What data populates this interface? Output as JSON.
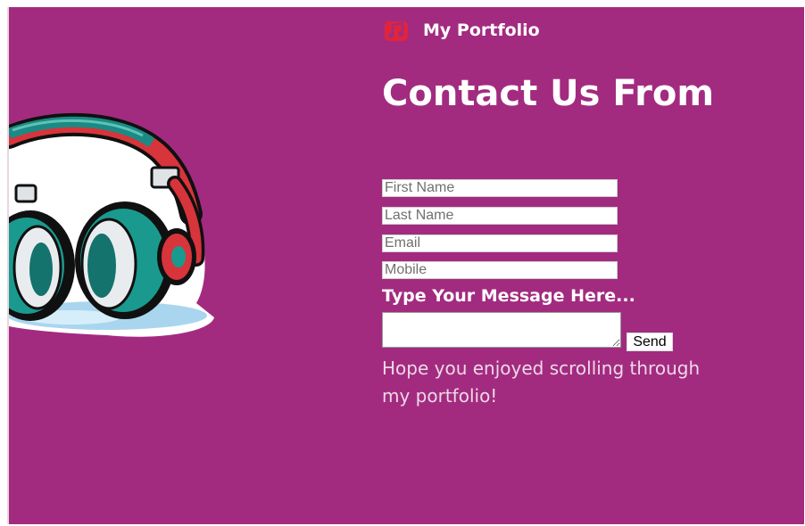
{
  "brand": {
    "title": "My Portfolio",
    "icon": "music-note-icon"
  },
  "contact": {
    "heading": "Contact Us From",
    "fields": {
      "first_name_placeholder": "First Name",
      "last_name_placeholder": "Last Name",
      "email_placeholder": "Email",
      "mobile_placeholder": "Mobile"
    },
    "message_label": "Type Your Message Here...",
    "send_label": "Send"
  },
  "footer": {
    "note": "Hope you enjoyed scrolling through my portfolio!"
  },
  "colors": {
    "background": "#a22b80",
    "text": "#ffffff",
    "muted_text": "#f0d8e6",
    "brand_icon": "#e0243c"
  },
  "hero": {
    "image": "headphones-illustration"
  }
}
